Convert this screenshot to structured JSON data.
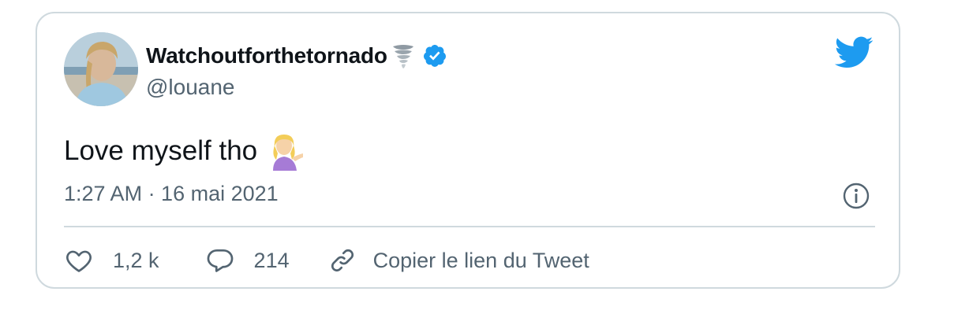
{
  "tweet": {
    "display_name": "Watchoutforthetornado",
    "handle": "@louane",
    "text": "Love myself tho",
    "timestamp": "1:27 AM · 16 mai 2021"
  },
  "actions": {
    "likes": "1,2 k",
    "replies": "214",
    "copy_link": "Copier le lien du Tweet"
  },
  "icons": {
    "twitter": "twitter-bird-icon",
    "verified": "verified-badge-icon",
    "tornado": "tornado-emoji-icon",
    "emoji": "person-tipping-hand-emoji-icon",
    "info": "info-icon",
    "like": "heart-icon",
    "reply": "speech-bubble-icon",
    "link": "link-icon"
  },
  "colors": {
    "twitter_blue": "#1d9bf0",
    "text_primary": "#0f1419",
    "text_secondary": "#536471",
    "border": "#cfd9de"
  }
}
